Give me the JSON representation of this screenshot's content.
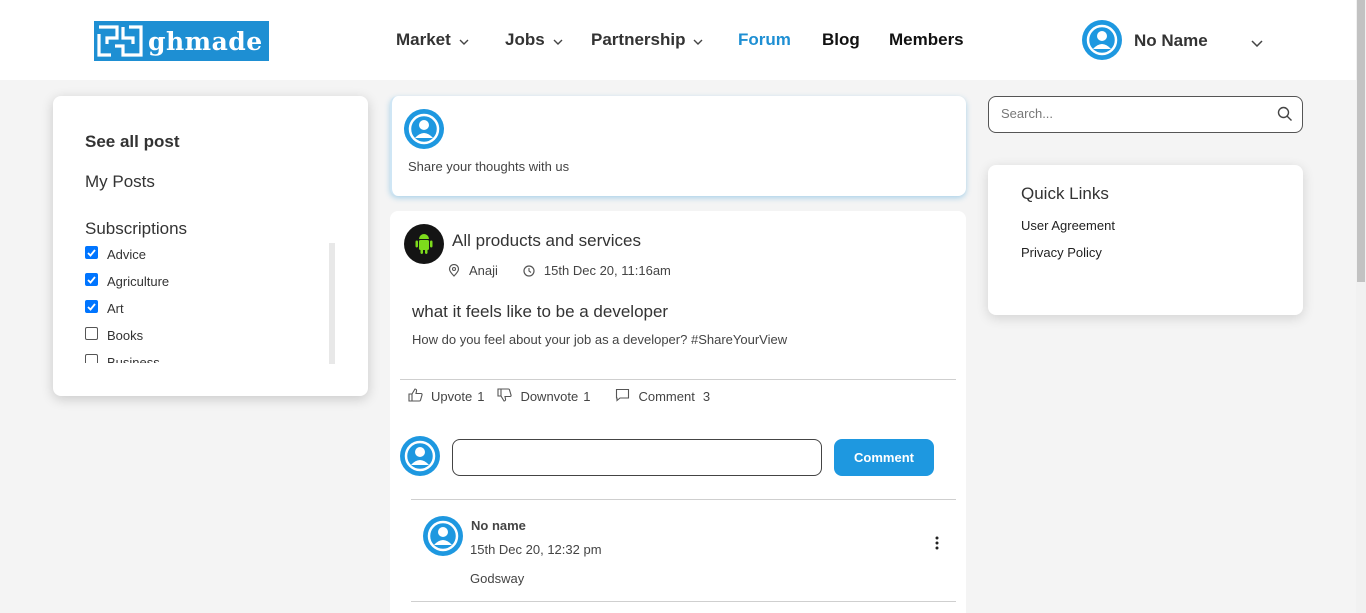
{
  "header": {
    "logo_text": "ghmade",
    "nav": [
      {
        "label": "Market",
        "dropdown": true
      },
      {
        "label": "Jobs",
        "dropdown": true
      },
      {
        "label": "Partnership",
        "dropdown": true
      },
      {
        "label": "Forum",
        "active": true
      },
      {
        "label": "Blog"
      },
      {
        "label": "Members"
      }
    ],
    "user_name": "No Name",
    "user_icon": "user-avatar-icon"
  },
  "sidebar": {
    "see_all": "See all post",
    "my_posts": "My Posts",
    "subscriptions_title": "Subscriptions",
    "subscriptions": [
      {
        "label": "Advice",
        "checked": true
      },
      {
        "label": "Agriculture",
        "checked": true
      },
      {
        "label": "Art",
        "checked": true
      },
      {
        "label": "Books",
        "checked": false
      },
      {
        "label": "Business",
        "checked": false
      }
    ]
  },
  "composer": {
    "prompt": "Share your thoughts with us"
  },
  "post": {
    "category": "All products and services",
    "location": "Anaji",
    "timestamp": "15th Dec 20, 11:16am",
    "title": "what it feels like to be a developer",
    "body": "How do you feel about your job as a developer? #ShareYourView",
    "upvote_label": "Upvote",
    "upvote_count": "1",
    "downvote_label": "Downvote",
    "downvote_count": "1",
    "comment_label": "Comment",
    "comment_count": "3",
    "comment_input_value": "",
    "comment_button": "Comment"
  },
  "comments": [
    {
      "author": "No name",
      "time": "15th Dec 20, 12:32 pm",
      "text": "Godsway"
    }
  ],
  "search": {
    "placeholder": "Search..."
  },
  "quick_links": {
    "title": "Quick Links",
    "links": [
      "User Agreement",
      "Privacy Policy"
    ]
  },
  "colors": {
    "accent": "#1e98e0",
    "brand": "#1e8fd3",
    "checkbox": "#0075ff",
    "background": "#f4f4f4"
  }
}
